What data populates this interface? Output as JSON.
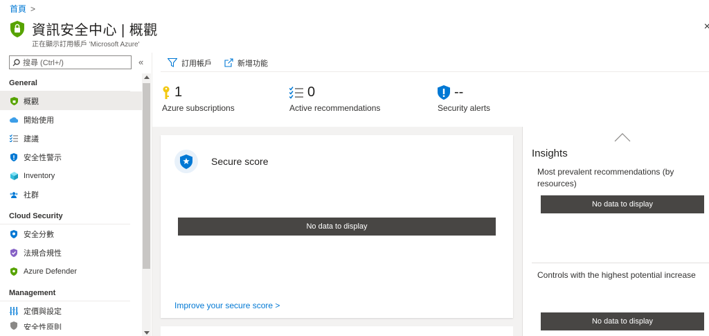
{
  "breadcrumb": {
    "home": "首頁",
    "sep": ">"
  },
  "header": {
    "title": "資訊安全中心 | 概觀",
    "subtitle": "正在顯示訂用帳戶 'Microsoft Azure'",
    "close": "×"
  },
  "sidebar": {
    "search_placeholder": "搜尋 (Ctrl+/)",
    "collapse": "«",
    "groups": [
      {
        "title": "General",
        "items": [
          {
            "label": "概觀",
            "icon": "shield-green-icon"
          },
          {
            "label": "開始使用",
            "icon": "cloud-icon"
          },
          {
            "label": "建議",
            "icon": "list-check-icon"
          },
          {
            "label": "安全性警示",
            "icon": "shield-blue-icon"
          },
          {
            "label": "Inventory",
            "icon": "cube-icon"
          },
          {
            "label": "社群",
            "icon": "community-icon"
          }
        ]
      },
      {
        "title": "Cloud Security",
        "items": [
          {
            "label": "安全分數",
            "icon": "secure-score-icon"
          },
          {
            "label": "法規合規性",
            "icon": "compliance-icon"
          },
          {
            "label": "Azure Defender",
            "icon": "defender-icon"
          }
        ]
      },
      {
        "title": "Management",
        "items": [
          {
            "label": "定價與設定",
            "icon": "settings-bars-icon"
          },
          {
            "label": "安全性原則",
            "icon": "policy-icon"
          }
        ]
      }
    ]
  },
  "toolbar": {
    "subscriptions": "訂用帳戶",
    "whats_new": "新增功能"
  },
  "stats": [
    {
      "value": "1",
      "label": "Azure subscriptions"
    },
    {
      "value": "0",
      "label": "Active recommendations"
    },
    {
      "value": "--",
      "label": "Security alerts"
    }
  ],
  "secure_score": {
    "title": "Secure score",
    "no_data": "No data to display",
    "link": "Improve your secure score >"
  },
  "insights": {
    "title": "Insights",
    "section1": "Most prevalent recommendations (by resources)",
    "section1_no_data": "No data to display",
    "section2": "Controls with the highest potential increase",
    "section2_no_data": "No data to display"
  },
  "colors": {
    "accent": "#0078d4",
    "nodata_bg": "#484644",
    "shield_green": "#57a300"
  }
}
